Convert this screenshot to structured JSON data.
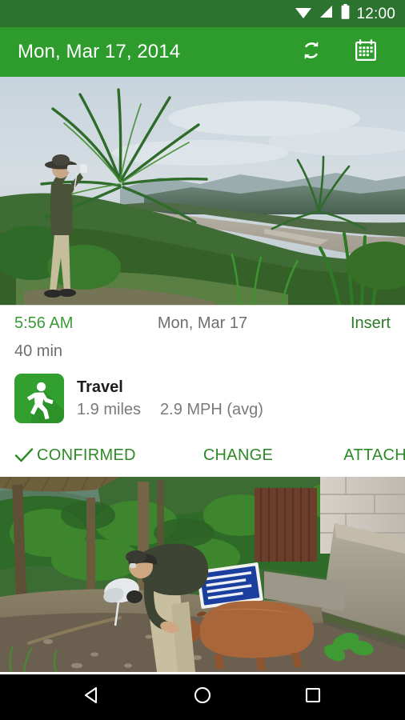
{
  "status_bar": {
    "clock": "12:00",
    "icons": [
      "wifi-icon",
      "cellular-signal-icon",
      "battery-icon"
    ],
    "background_color": "#2c7330"
  },
  "app_bar": {
    "title": "Mon, Mar 17, 2014",
    "background_color": "#2e9c2c",
    "actions": [
      {
        "name": "sync-icon",
        "label": "Sync"
      },
      {
        "name": "calendar-icon",
        "label": "Calendar"
      }
    ]
  },
  "photo_top": {
    "alt": "Person in hat looking through binoculars beside tall palm fronds on a jungle ridge overlooking a wide river valley"
  },
  "entry_card": {
    "time": "5:56 AM",
    "date": "Mon, Mar 17",
    "insert_label": "Insert",
    "duration": "40 min",
    "activity": {
      "icon": "walking-person-icon",
      "icon_color": "#32a02f",
      "name": "Travel",
      "distance": "1.9 miles",
      "speed": "2.9 MPH (avg)"
    },
    "actions": [
      {
        "name": "confirmed-button",
        "label": "CONFIRMED",
        "icon": "check-icon"
      },
      {
        "name": "change-button",
        "label": "CHANGE"
      },
      {
        "name": "attach-button",
        "label": "ATTACH"
      }
    ],
    "accent_color": "#2c8a26"
  },
  "photo_bottom": {
    "alt": "Person bending down to pet a capybara on a dirt path beside a concrete block wall with a blue sign"
  },
  "nav_bar": {
    "buttons": [
      {
        "name": "back-button",
        "label": "Back"
      },
      {
        "name": "home-button",
        "label": "Home"
      },
      {
        "name": "recents-button",
        "label": "Recents"
      }
    ]
  }
}
